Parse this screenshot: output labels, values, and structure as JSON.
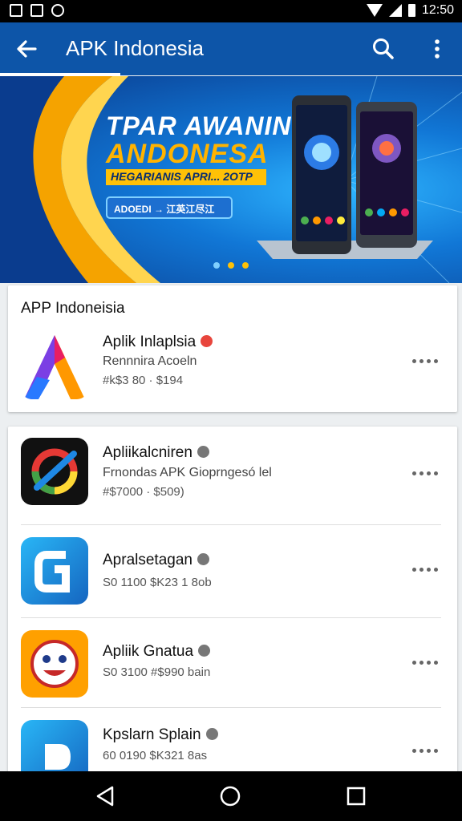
{
  "status_bar": {
    "time": "12:50",
    "left_icons": [
      "image-icon",
      "image-icon",
      "circle-notification-icon"
    ],
    "right_icons": [
      "wifi-icon",
      "signal-icon",
      "battery-icon"
    ]
  },
  "app_bar": {
    "title": "APK Indonesia",
    "background": "#0d55a8",
    "back_icon": "arrow-back-icon",
    "search_icon": "search-icon",
    "more_icon": "more-vert-icon"
  },
  "banner": {
    "title_line1": "TPAR AWANIN",
    "title_line2": "ANDONESA",
    "strip_text": "HEGARIANIS APRI... 2OTP",
    "button_text": "ADOEDI  → 江英江尽江",
    "page_dots": 3,
    "active_dot": 0
  },
  "featured_section": {
    "title": "APP Indoneisia",
    "app": {
      "name": "Aplik Inlaplsia",
      "subtitle": "Rennnira Acoeln",
      "meta": "#k$3 80 · $194",
      "icon": "triangle-a-logo-icon",
      "badge_color": "#e8453c"
    }
  },
  "app_list": [
    {
      "name": "Apliikalcniren",
      "subtitle": "Frnondas APK Gioprngesó lel",
      "meta": "#$7000 · $509)",
      "icon": "colorful-ring-logo-icon"
    },
    {
      "name": "Apralsetagan",
      "subtitle": "",
      "meta": "S0 1100  $K23 1 8ob",
      "icon": "blue-g-logo-icon"
    },
    {
      "name": "Apliik Gnatua",
      "subtitle": "",
      "meta": "S0 3100  #$990 bain",
      "icon": "smiley-face-logo-icon"
    },
    {
      "name": "Kpslarn Splain",
      "subtitle": "",
      "meta": "60 0190  $K321 8as",
      "icon": "blue-d-logo-icon"
    }
  ],
  "nav_bar": {
    "back_icon": "nav-back-icon",
    "home_icon": "nav-home-icon",
    "recents_icon": "nav-recents-icon"
  }
}
